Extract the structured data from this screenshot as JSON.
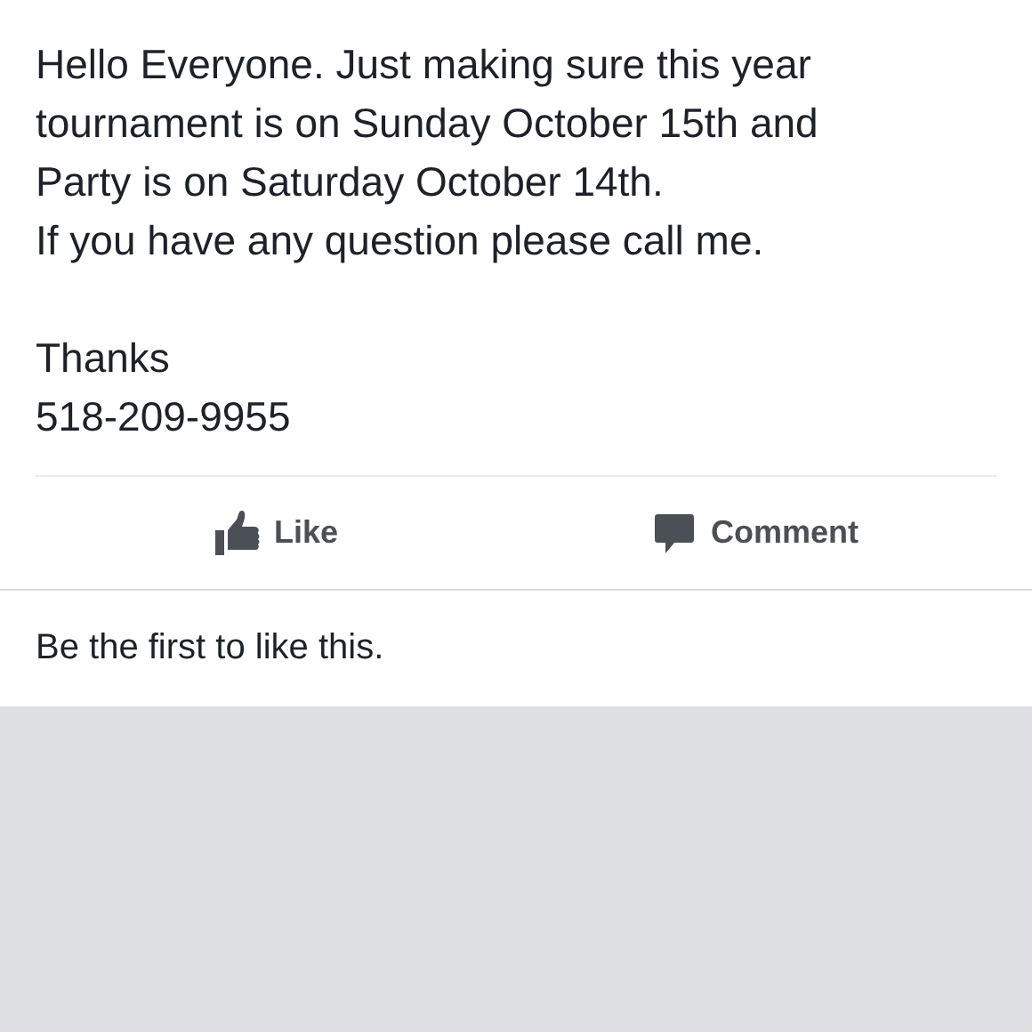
{
  "post": {
    "message": "Hello Everyone. Just making sure this year\ntournament is on Sunday October 15th and\nParty is on Saturday October 14th.\nIf you have any question please call me.\n\nThanks\n518-209-9955"
  },
  "actions": [
    {
      "kind": "like",
      "label": "Like"
    },
    {
      "kind": "comment",
      "label": "Comment"
    }
  ],
  "likes_summary": "Be the first to like this."
}
